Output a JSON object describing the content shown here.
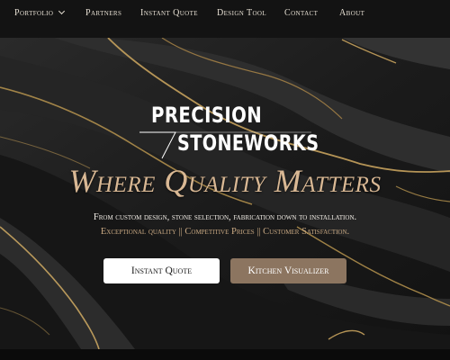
{
  "nav": {
    "items": [
      {
        "label": "Portfolio",
        "has_dropdown": true
      },
      {
        "label": "Partners"
      },
      {
        "label": "Instant Quote"
      },
      {
        "label": "Design Tool"
      },
      {
        "label": "Contact"
      },
      {
        "label": "About"
      }
    ]
  },
  "logo": {
    "line1": "PRECISION",
    "line2": "STONEWORKS"
  },
  "hero": {
    "tagline": "Where Quality Matters",
    "subtitle": "From custom design, stone selection, fabrication down to installation.",
    "highlights": "Exceptional quality || Competitive Prices || Customer Satisfaction."
  },
  "buttons": {
    "quote_label": "Instant Quote",
    "visualizer_label": "Kitchen Visualizer"
  },
  "colors": {
    "nav_bg": "#131313",
    "accent_gold": "#d9b894",
    "visualizer_button": "#8c7560",
    "quote_button": "#ffffff"
  }
}
